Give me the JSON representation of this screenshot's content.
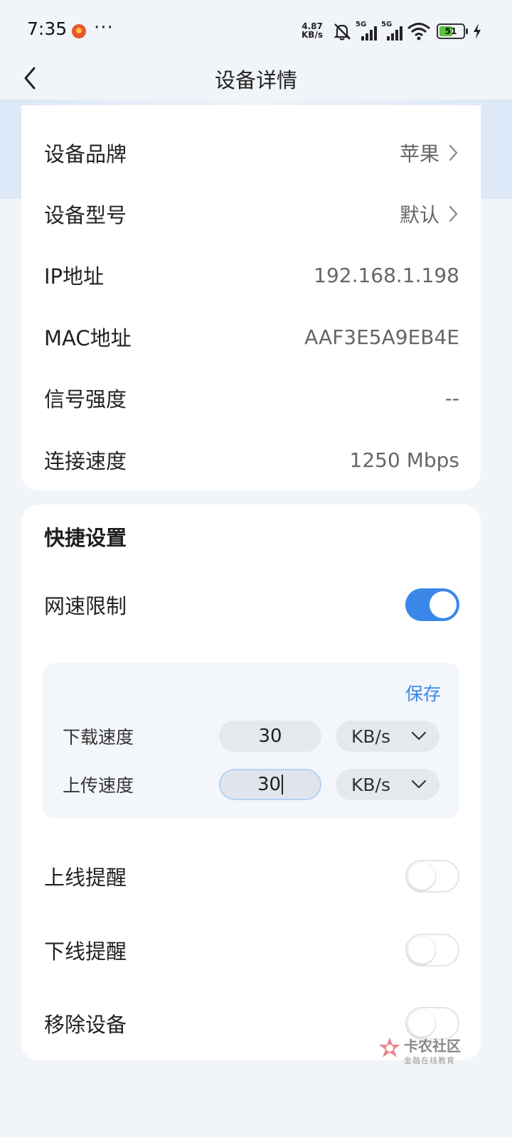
{
  "status": {
    "time": "7:35",
    "dots": "···",
    "net_speed_value": "4.87",
    "net_speed_unit": "KB/s",
    "sig1_tag": "5G",
    "sig2_tag": "5G",
    "battery": "51"
  },
  "header": {
    "title": "设备详情"
  },
  "device_info": {
    "brand_label": "设备品牌",
    "brand_value": "苹果",
    "model_label": "设备型号",
    "model_value": "默认",
    "ip_label": "IP地址",
    "ip_value": "192.168.1.198",
    "mac_label": "MAC地址",
    "mac_value": "AAF3E5A9EB4E",
    "signal_label": "信号强度",
    "signal_value": "--",
    "speed_label": "连接速度",
    "speed_value": "1250 Mbps"
  },
  "quick": {
    "title": "快捷设置",
    "limit_label": "网速限制",
    "limit_on": true,
    "save_label": "保存",
    "download_label": "下载速度",
    "download_value": "30",
    "download_unit": "KB/s",
    "upload_label": "上传速度",
    "upload_value": "30",
    "upload_unit": "KB/s",
    "online_label": "上线提醒",
    "online_on": false,
    "offline_label": "下线提醒",
    "offline_on": false,
    "remove_label": "移除设备",
    "remove_on": false
  },
  "watermark": {
    "name": "卡农社区",
    "sub": "金融在线教育"
  },
  "colors": {
    "accent": "#3a87e9",
    "background": "#f1f4f8"
  }
}
